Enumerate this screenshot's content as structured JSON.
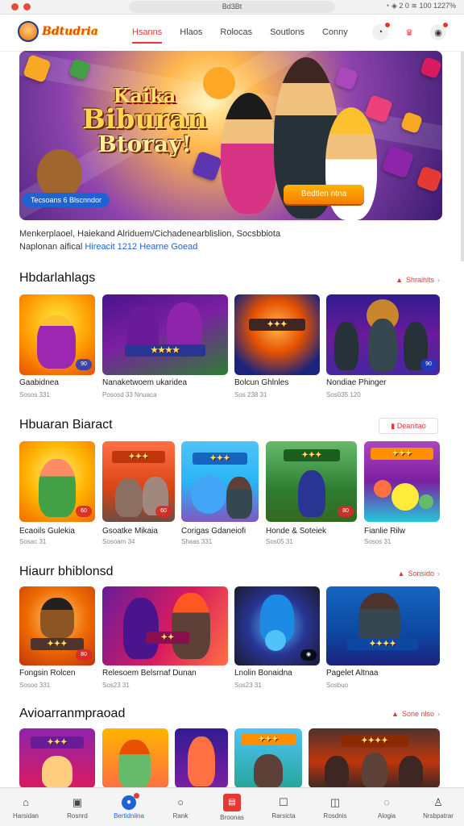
{
  "browser": {
    "url": "Bd3Bt",
    "status": "◔ ◈ 2 0 ≋ 100 1227%"
  },
  "header": {
    "logo_text": "Bdtudria",
    "nav": [
      "Hsanns",
      "Hlaos",
      "Rolocas",
      "Soutlons",
      "Conny"
    ]
  },
  "hero": {
    "title_line1": "Kaika",
    "title_line2": "Biburan",
    "title_line3": "Btoray!",
    "left_button": "Tecsoans 6 Blscnndor",
    "right_button": "Bedtlen ntna"
  },
  "description": {
    "line1": "Menkerplaoel, Haiekand Alriduem/Cichadenearblislion, Socsbbiota",
    "line2_prefix": "Naplonan aifical ",
    "line2_link": "Hireacit 1212 Hearne Goead"
  },
  "sections": [
    {
      "title": "Hbdarlahlags",
      "more": "Shraihlts",
      "cards": [
        {
          "title": "Gaabidnea",
          "sub": "Sosos 331",
          "badge": "90"
        },
        {
          "title": "Nanaketwoem ukaridea",
          "sub": "Pososd 33 Nnuaca",
          "badge": ""
        },
        {
          "title": "Bolcun Ghlnles",
          "sub": "Sos 238 31",
          "badge": ""
        },
        {
          "title": "Nondiae Phinger",
          "sub": "Sos035 120",
          "badge": "90"
        }
      ]
    },
    {
      "title": "Hbuaran Biaract",
      "more": "Deanitao",
      "cards": [
        {
          "title": "Ecaoils Gulekia",
          "sub": "Sosac 31",
          "badge": "60"
        },
        {
          "title": "Gsoatke Mikaia",
          "sub": "Sosoam 34",
          "badge": "60"
        },
        {
          "title": "Corigas Gdaneiofi",
          "sub": "Shaas 331",
          "badge": ""
        },
        {
          "title": "Honde & Soteiek",
          "sub": "Sos05 31",
          "badge": "80"
        },
        {
          "title": "Fianlie Rilw",
          "sub": "Sosos 31",
          "badge": ""
        }
      ]
    },
    {
      "title": "Hiaurr bhiblonsd",
      "more": "Sonsido",
      "cards": [
        {
          "title": "Fongsin Rolcen",
          "sub": "Sosoo 331",
          "badge": "80"
        },
        {
          "title": "Relesoem Belsrnaf Dunan",
          "sub": "Sos23 31",
          "badge": ""
        },
        {
          "title": "Lnolin Bonaidna",
          "sub": "Sos23 31",
          "badge": ""
        },
        {
          "title": "Pagelet Altnaa",
          "sub": "Sosbuo",
          "badge": ""
        }
      ]
    },
    {
      "title": "Avioarranmpraoad",
      "more": "Sone nlso",
      "cards": [
        {
          "title": "",
          "sub": "",
          "badge": ""
        },
        {
          "title": "",
          "sub": "",
          "badge": ""
        },
        {
          "title": "",
          "sub": "",
          "badge": ""
        },
        {
          "title": "",
          "sub": "",
          "badge": ""
        },
        {
          "title": "",
          "sub": "",
          "badge": ""
        }
      ]
    }
  ],
  "bottom_nav": [
    {
      "label": "Harsidan",
      "icon": "home-icon"
    },
    {
      "label": "Rosnrd",
      "icon": "gallery-icon"
    },
    {
      "label": "Bertidniina",
      "icon": "circle-icon"
    },
    {
      "label": "Rank",
      "icon": "search-icon"
    },
    {
      "label": "Broonas",
      "icon": "document-icon"
    },
    {
      "label": "Rarsicta",
      "icon": "chat-icon"
    },
    {
      "label": "Rosdnis",
      "icon": "box-icon"
    },
    {
      "label": "Alogia",
      "icon": "bell-icon"
    },
    {
      "label": "Nrsbpatrar",
      "icon": "user-icon"
    }
  ],
  "colors": {
    "accent": "#e53935",
    "link": "#1e63d6"
  }
}
